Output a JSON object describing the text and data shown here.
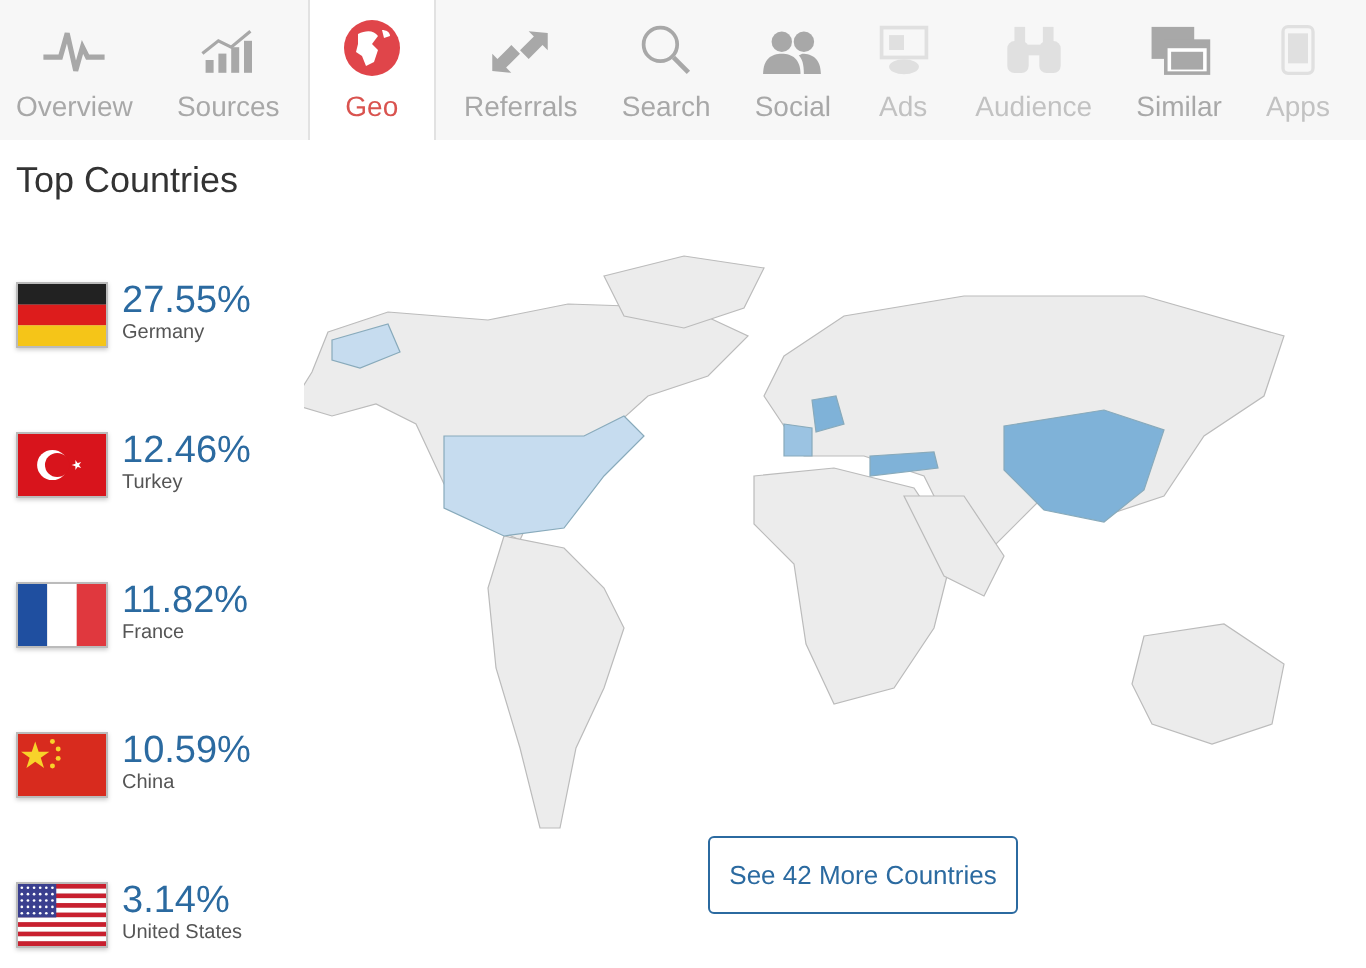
{
  "tabs": [
    {
      "label": "Overview",
      "selected": false,
      "disabled": false
    },
    {
      "label": "Sources",
      "selected": false,
      "disabled": false
    },
    {
      "label": "Geo",
      "selected": true,
      "disabled": false
    },
    {
      "label": "Referrals",
      "selected": false,
      "disabled": false
    },
    {
      "label": "Search",
      "selected": false,
      "disabled": false
    },
    {
      "label": "Social",
      "selected": false,
      "disabled": false
    },
    {
      "label": "Ads",
      "selected": false,
      "disabled": true
    },
    {
      "label": "Audience",
      "selected": false,
      "disabled": true
    },
    {
      "label": "Similar",
      "selected": false,
      "disabled": false
    },
    {
      "label": "Apps",
      "selected": false,
      "disabled": true
    }
  ],
  "title": "Top Countries",
  "countries": [
    {
      "share": "27.55%",
      "name": "Germany"
    },
    {
      "share": "12.46%",
      "name": "Turkey"
    },
    {
      "share": "11.82%",
      "name": "France"
    },
    {
      "share": "10.59%",
      "name": "China"
    },
    {
      "share": "3.14%",
      "name": "United States"
    }
  ],
  "more_button": "See 42 More Countries"
}
